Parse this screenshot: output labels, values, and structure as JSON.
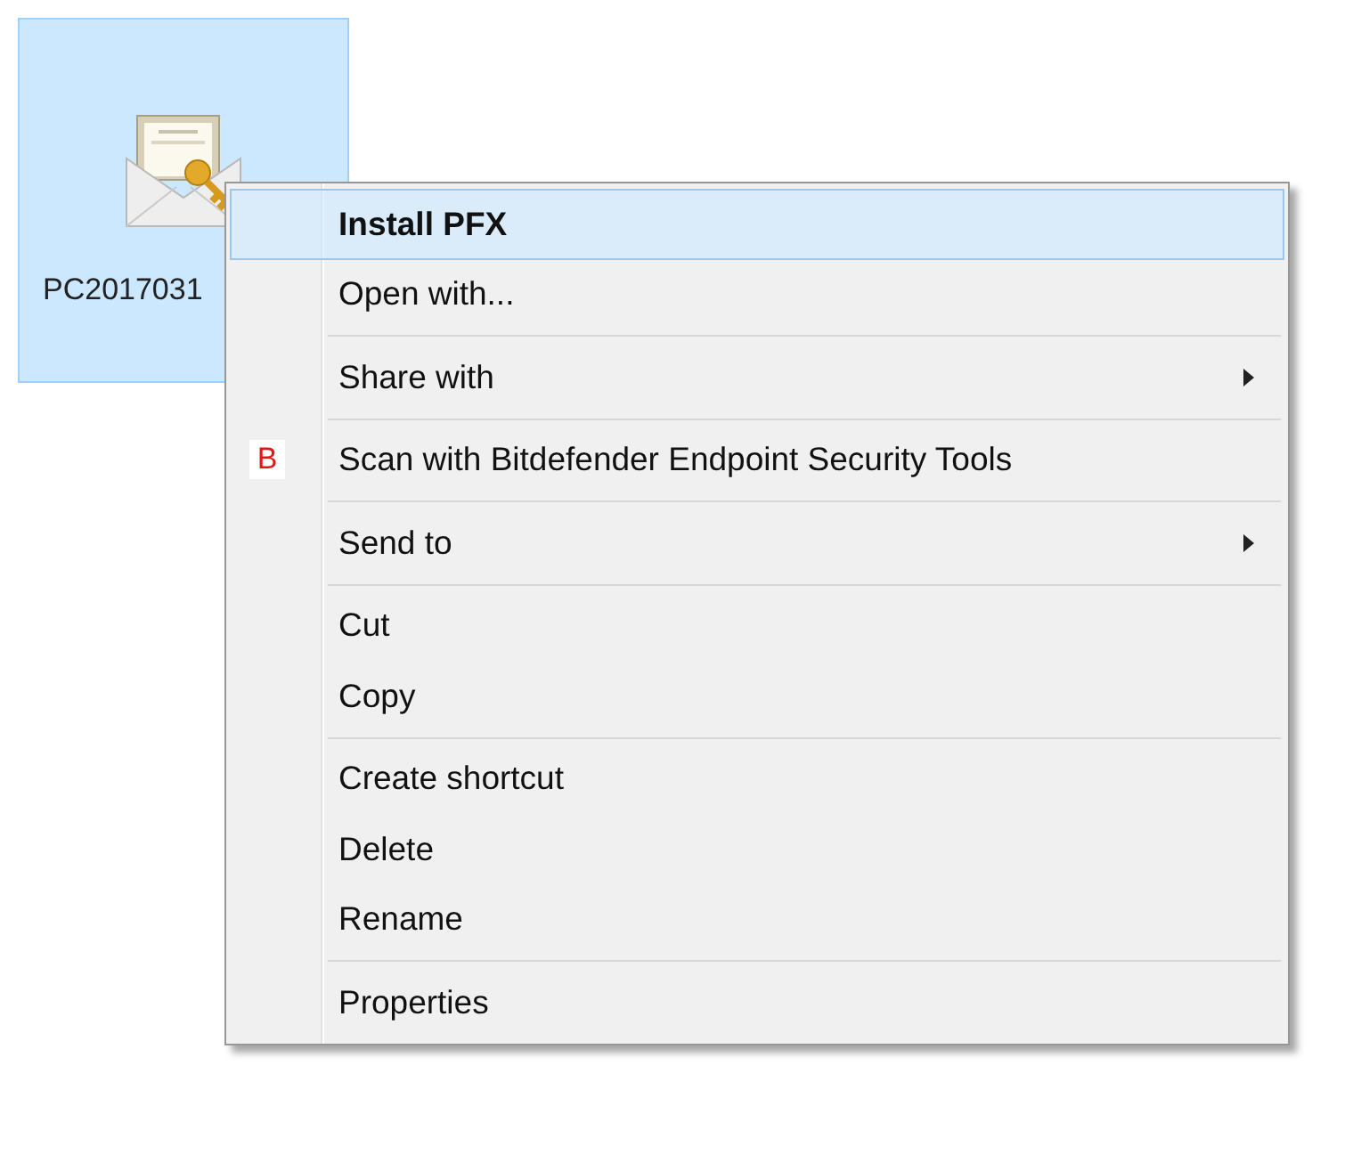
{
  "desktop_icon": {
    "label": "PC2017031",
    "selected": true
  },
  "context_menu": {
    "groups": [
      [
        {
          "label": "Install PFX",
          "default": true,
          "selected": true,
          "submenu": false
        },
        {
          "label": "Open with...",
          "default": false,
          "selected": false,
          "submenu": false
        }
      ],
      [
        {
          "label": "Share with",
          "default": false,
          "selected": false,
          "submenu": true
        }
      ],
      [
        {
          "label": "Scan with Bitdefender Endpoint Security Tools",
          "default": false,
          "selected": false,
          "submenu": false,
          "badge": "B"
        }
      ],
      [
        {
          "label": "Send to",
          "default": false,
          "selected": false,
          "submenu": true
        }
      ],
      [
        {
          "label": "Cut",
          "default": false,
          "selected": false,
          "submenu": false
        },
        {
          "label": "Copy",
          "default": false,
          "selected": false,
          "submenu": false
        }
      ],
      [
        {
          "label": "Create shortcut",
          "default": false,
          "selected": false,
          "submenu": false
        },
        {
          "label": "Delete",
          "default": false,
          "selected": false,
          "submenu": false
        },
        {
          "label": "Rename",
          "default": false,
          "selected": false,
          "submenu": false
        }
      ],
      [
        {
          "label": "Properties",
          "default": false,
          "selected": false,
          "submenu": false
        }
      ]
    ]
  }
}
